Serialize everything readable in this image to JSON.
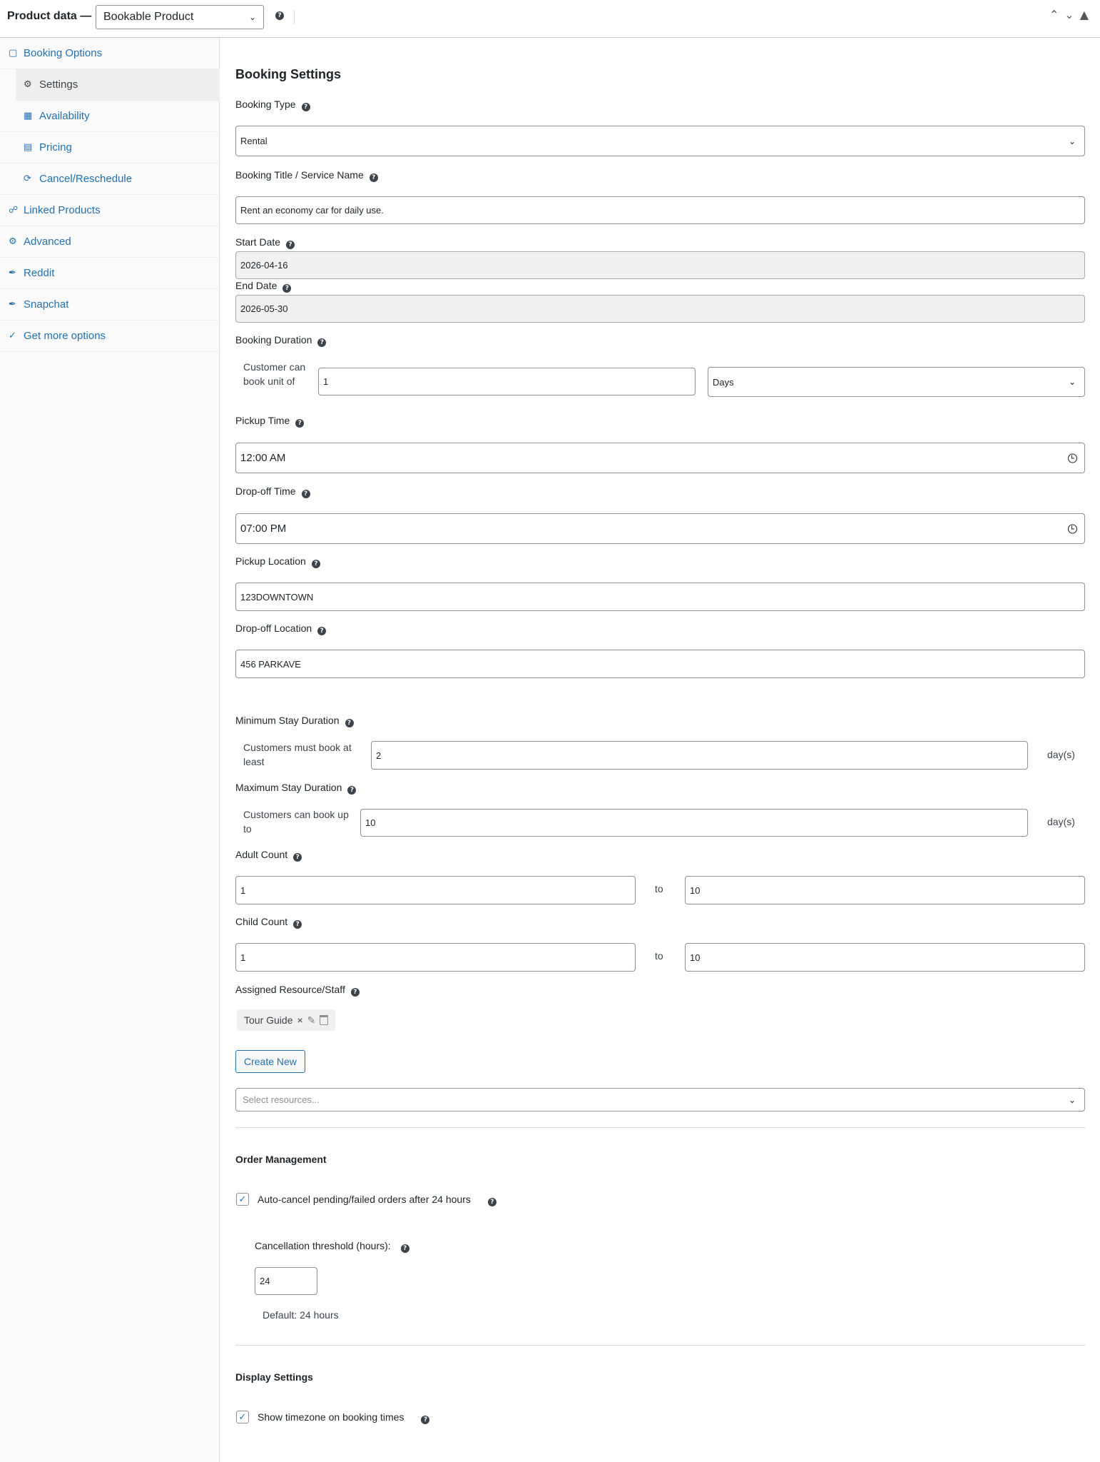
{
  "header": {
    "title": "Product data —",
    "product_type": "Bookable Product"
  },
  "sidebar": {
    "items": [
      {
        "label": "Booking Options",
        "icon": "book-icon"
      },
      {
        "label": "Settings",
        "icon": "gear-icon"
      },
      {
        "label": "Availability",
        "icon": "calendar-icon"
      },
      {
        "label": "Pricing",
        "icon": "list-icon"
      },
      {
        "label": "Cancel/Reschedule",
        "icon": "refresh-icon"
      },
      {
        "label": "Linked Products",
        "icon": "link-icon"
      },
      {
        "label": "Advanced",
        "icon": "gear-icon"
      },
      {
        "label": "Reddit",
        "icon": "wrench-icon"
      },
      {
        "label": "Snapchat",
        "icon": "wrench-icon"
      },
      {
        "label": "Get more options",
        "icon": "plugin-icon"
      }
    ]
  },
  "main": {
    "title": "Booking Settings",
    "booking_type": {
      "label": "Booking Type",
      "value": "Rental"
    },
    "booking_title": {
      "label": "Booking Title / Service Name",
      "value": "Rent an economy car for daily use."
    },
    "start_date": {
      "label": "Start Date",
      "value": "2026-04-16"
    },
    "end_date": {
      "label": "End Date",
      "value": "2026-05-30"
    },
    "booking_duration": {
      "label": "Booking Duration",
      "prefix": "Customer can book unit of",
      "value": "1",
      "unit": "Days"
    },
    "pickup_time": {
      "label": "Pickup Time",
      "value": "12:00 AM"
    },
    "dropoff_time": {
      "label": "Drop-off Time",
      "value": "07:00 PM"
    },
    "pickup_location": {
      "label": "Pickup Location",
      "value": "123DOWNTOWN"
    },
    "dropoff_location": {
      "label": "Drop-off Location",
      "value": "456 PARKAVE"
    },
    "min_stay": {
      "label": "Minimum Stay Duration",
      "prefix": "Customers must book at least",
      "value": "2",
      "unit": "day(s)"
    },
    "max_stay": {
      "label": "Maximum Stay Duration",
      "prefix": "Customers can book up to",
      "value": "10",
      "unit": "day(s)"
    },
    "adult_count": {
      "label": "Adult Count",
      "min": "1",
      "to": "to",
      "max": "10"
    },
    "child_count": {
      "label": "Child Count",
      "min": "1",
      "to": "to",
      "max": "10"
    },
    "resources": {
      "label": "Assigned Resource/Staff",
      "tag": "Tour Guide",
      "remove_glyph": "×",
      "edit_glyph": "✎",
      "create_label": "Create New",
      "placeholder": "Select resources..."
    },
    "order_management": {
      "title": "Order Management",
      "auto_cancel_label": "Auto-cancel pending/failed orders after 24 hours",
      "threshold_label": "Cancellation threshold (hours):",
      "threshold_value": "24",
      "default_note": "Default: 24 hours"
    },
    "display_settings": {
      "title": "Display Settings",
      "timezone_label": "Show timezone on booking times"
    }
  }
}
